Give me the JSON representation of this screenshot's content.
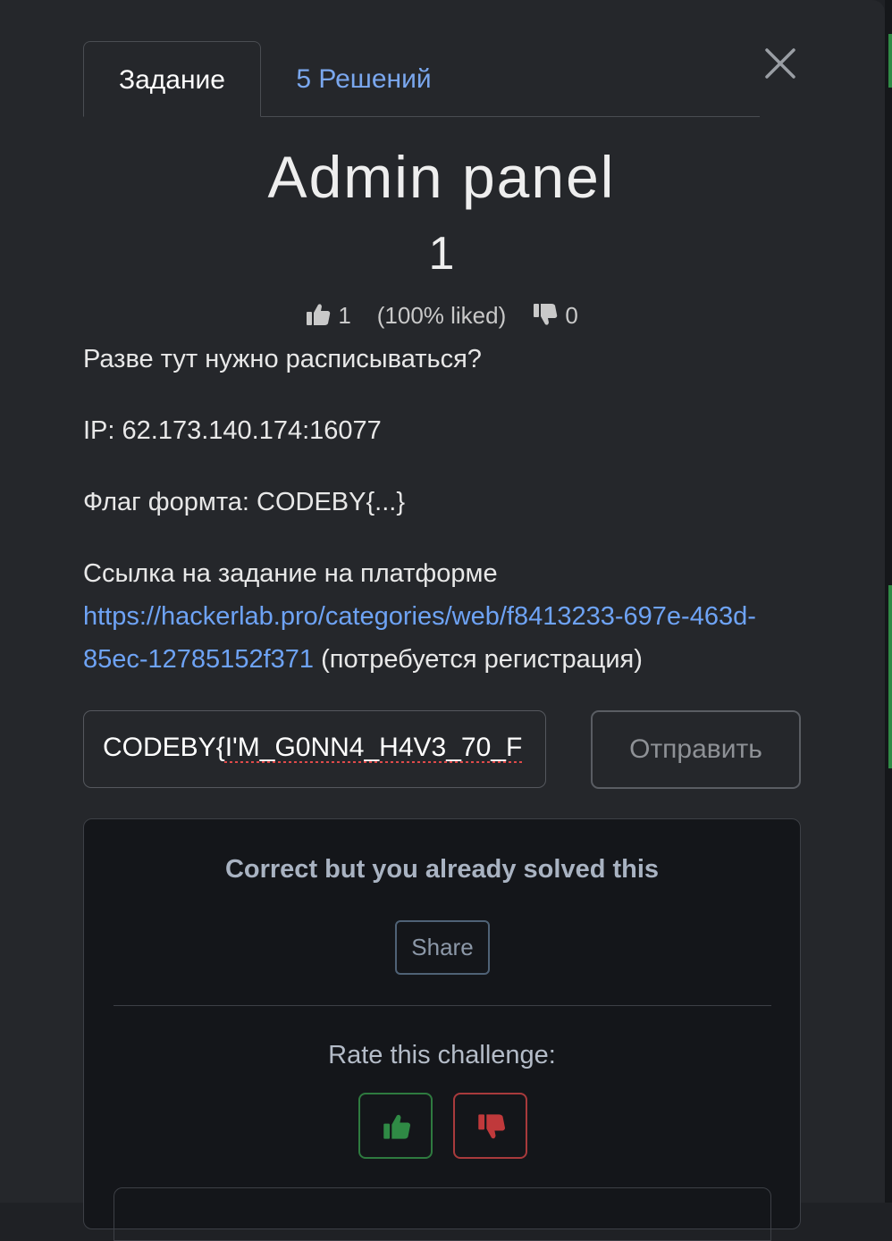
{
  "tabs": {
    "task_label": "Задание",
    "solutions_label": "5 Решений"
  },
  "challenge": {
    "title": "Admin panel",
    "points": "1",
    "likes_count": "1",
    "liked_percent": "(100% liked)",
    "dislikes_count": "0"
  },
  "description": {
    "line1": "Разве тут нужно расписываться?",
    "ip_line": "IP: 62.173.140.174:16077",
    "flag_format_line": "Флаг формта: CODEBY{...}",
    "link_intro": "Ссылка на задание на платформе",
    "link_url": "https://hackerlab.pro/categories/web/f8413233-697e-463d-85ec-12785152f371",
    "link_note": "(потребуется регистрация)"
  },
  "flag_form": {
    "input_prefix": "CODEBY{",
    "input_rest": "I'M_G0NN4_H4V3_70_F",
    "submit_label": "Отправить"
  },
  "result": {
    "message": "Correct but you already solved this",
    "share_label": "Share",
    "rate_label": "Rate this challenge:"
  },
  "colors": {
    "link": "#6ea3f5",
    "thumbs_up": "#2f8a45",
    "thumbs_down": "#c0393b"
  },
  "icons": {
    "close": "close-icon",
    "thumbs_up": "thumbs-up-icon",
    "thumbs_down": "thumbs-down-icon"
  }
}
